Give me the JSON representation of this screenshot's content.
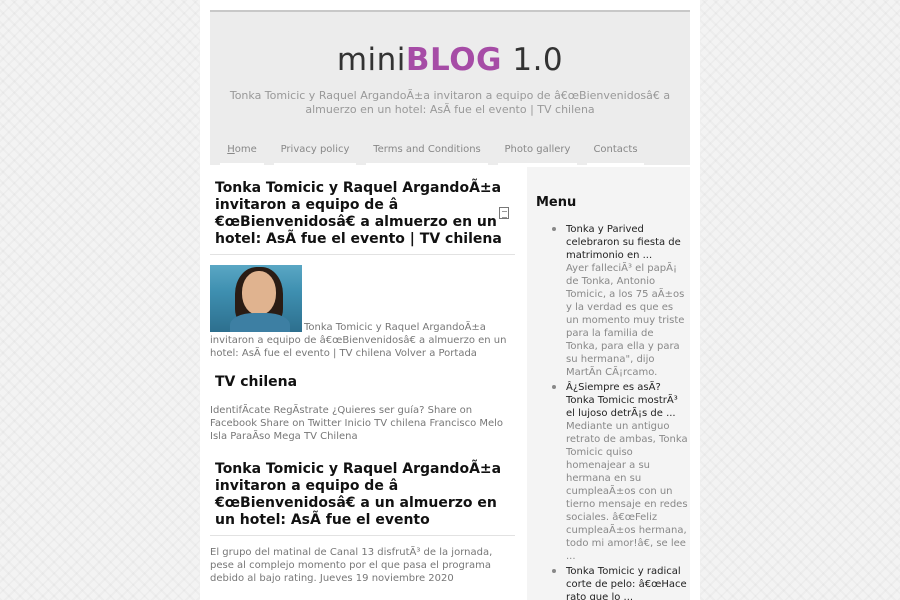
{
  "header": {
    "logo_prefix": "mini",
    "logo_highlight": "BLOG",
    "logo_suffix": " 1.0",
    "tagline": "Tonka Tomicic y Raquel ArgandoÃ±a invitaron a equipo de â€œBienvenidosâ€ a almuerzo en un hotel: AsÃ fue el evento | TV chilena"
  },
  "nav": {
    "home_first": "H",
    "home_rest": "ome",
    "items": [
      "Privacy policy",
      "Terms and Conditions",
      "Photo gallery",
      "Contacts"
    ]
  },
  "main": {
    "post1_title": "Tonka Tomicic y Raquel ArgandoÃ±a invitaron a equipo de â €œBienvenidosâ€ a almuerzo en un hotel: AsÃ fue el evento | TV chilena",
    "post1_excerpt": "Tonka Tomicic y Raquel ArgandoÃ±a invitaron a equipo de â€œBienvenidosâ€ a almuerzo en un hotel: AsÃ fue el evento | TV chilena Volver a Portada",
    "section_title": "TV chilena",
    "section_text": "IdentifÃ­cate RegÃ­strate ¿Quieres ser guía? Share on Facebook Share on Twitter Inicio TV chilena Francisco Melo Isla ParaÃ­so Mega TV Chilena",
    "post2_title": "Tonka Tomicic y Raquel ArgandoÃ±a invitaron a equipo de â €œBienvenidosâ€ a un almuerzo en un hotel: AsÃ fue el evento",
    "post2_excerpt": "El grupo del matinal de Canal 13 disfrutÃ³ de la jornada, pese al complejo momento por el que pasa el programa debido al bajo rating. Jueves 19 noviembre 2020"
  },
  "sidebar": {
    "heading": "Menu",
    "items": [
      {
        "title": "Tonka y Parived celebraron su fiesta de matrimonio en ...",
        "text": "Ayer falleciÃ³ el papÃ¡ de Tonka, Antonio Tomicic, a los 75 aÃ±os y la verdad es que es un momento muy triste para la familia de Tonka, para ella y para su hermana\", dijo MartÃ­n CÃ¡rcamo."
      },
      {
        "title": "Â¿Siempre es asÃ? Tonka Tomicic mostrÃ³ el lujoso detrÃ¡s de ...",
        "text": "Mediante un antiguo retrato de ambas, Tonka Tomicic quiso homenajear a su hermana en su cumpleaÃ±os con un tierno mensaje en redes sociales. â€œFeliz cumpleaÃ±os hermana, todo mi amor!â€, se lee ..."
      },
      {
        "title": "Tonka Tomicic y radical corte de pelo: â€œHace rato que lo ...",
        "text": ""
      }
    ]
  },
  "colors": {
    "brand": "#a64ca6",
    "header_bg": "#ececec",
    "sidebar_bg": "#f4f4f4"
  }
}
